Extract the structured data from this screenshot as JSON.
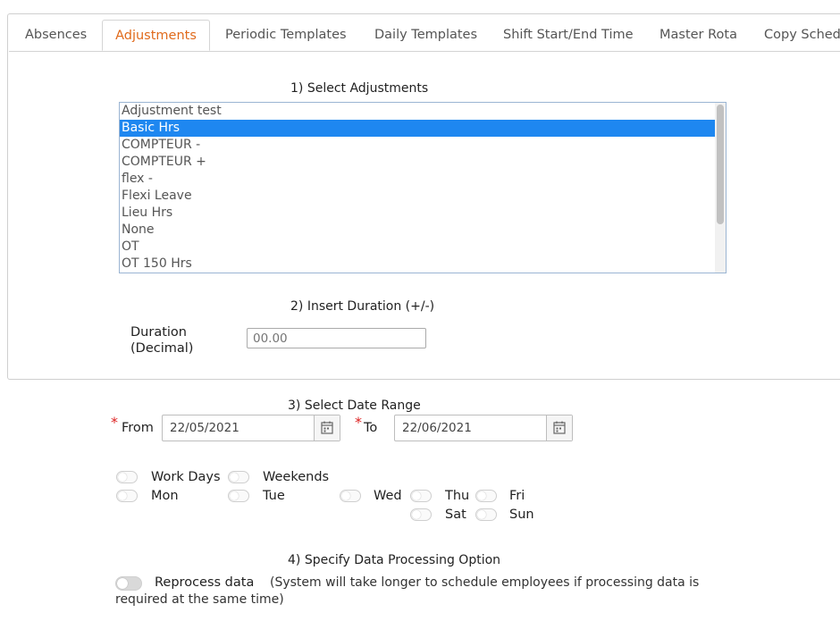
{
  "tabs": [
    {
      "label": "Absences",
      "active": false
    },
    {
      "label": "Adjustments",
      "active": true
    },
    {
      "label": "Periodic Templates",
      "active": false
    },
    {
      "label": "Daily Templates",
      "active": false
    },
    {
      "label": "Shift Start/End Time",
      "active": false
    },
    {
      "label": "Master Rota",
      "active": false
    },
    {
      "label": "Copy Sched",
      "active": false
    }
  ],
  "section1": {
    "title": "1) Select Adjustments",
    "options": [
      "Adjustment test",
      "Basic Hrs",
      "COMPTEUR -",
      "COMPTEUR +",
      "flex -",
      "Flexi Leave",
      "Lieu Hrs",
      "None",
      "OT",
      "OT 150 Hrs"
    ],
    "selected": "Basic Hrs"
  },
  "section2": {
    "title": "2) Insert Duration (+/-)",
    "duration_label_line1": "Duration",
    "duration_label_line2": "(Decimal)",
    "duration_placeholder": "00.00"
  },
  "section3": {
    "title": "3) Select Date Range",
    "required_mark": "*",
    "from_label": "From",
    "from_value": "22/05/2021",
    "to_label": "To",
    "to_value": "22/06/2021",
    "days": {
      "work_days": "Work Days",
      "weekends": "Weekends",
      "mon": "Mon",
      "tue": "Tue",
      "wed": "Wed",
      "thu": "Thu",
      "fri": "Fri",
      "sat": "Sat",
      "sun": "Sun"
    }
  },
  "section4": {
    "title": "4) Specify Data Processing Option",
    "reprocess_label": "Reprocess data",
    "reprocess_note_line1": "(System will take longer to schedule employees if processing data is",
    "reprocess_note_line2": "required at the same time)"
  },
  "colors": {
    "accent": "#e06a1b",
    "selection": "#1e87f0",
    "required": "#dd2222"
  }
}
